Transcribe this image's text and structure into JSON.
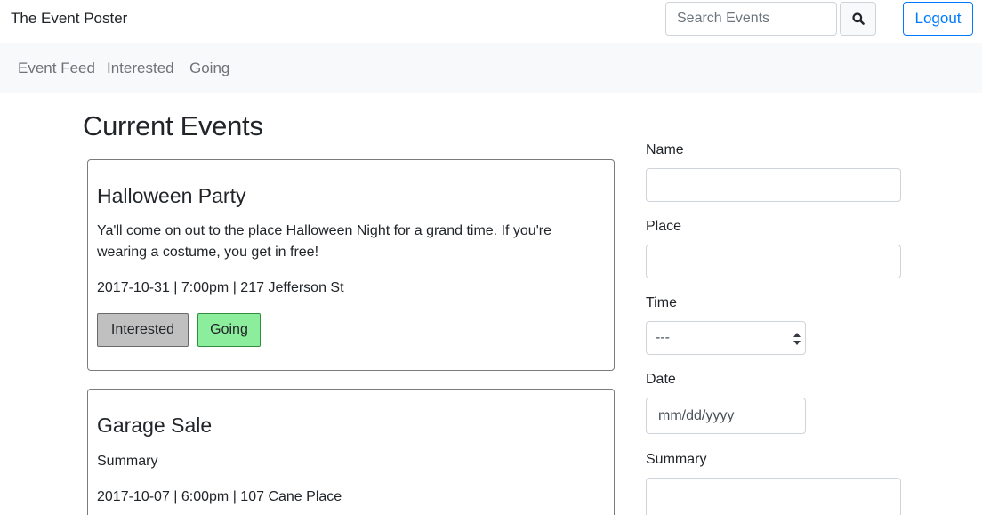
{
  "header": {
    "brand": "The Event Poster",
    "search_placeholder": "Search Events",
    "search_icon": "search-icon",
    "logout_label": "Logout"
  },
  "nav": {
    "items": [
      {
        "label": "Event Feed"
      },
      {
        "label": "Interested"
      },
      {
        "label": "Going"
      }
    ]
  },
  "main": {
    "title": "Current Events",
    "events": [
      {
        "title": "Halloween Party",
        "summary_line1": "Ya'll come on out to the place Halloween Night for a grand time. If you're",
        "summary_line2": "wearing a costume, you get in free!",
        "details": "2017-10-31 | 7:00pm | 217 Jefferson St",
        "interested_label": "Interested",
        "going_label": "Going"
      },
      {
        "title": "Garage Sale",
        "summary_line1": "Summary",
        "details": "2017-10-07 | 6:00pm | 107 Cane Place"
      }
    ]
  },
  "form": {
    "name_label": "Name",
    "place_label": "Place",
    "time_label": "Time",
    "time_value": "---",
    "date_label": "Date",
    "date_placeholder": "mm/dd/yyyy",
    "summary_label": "Summary"
  },
  "colors": {
    "accent": "#007bff",
    "interested_bg": "#c0c0c0",
    "going_bg": "#8cee9c",
    "nav_bg": "#f8f9fa"
  }
}
